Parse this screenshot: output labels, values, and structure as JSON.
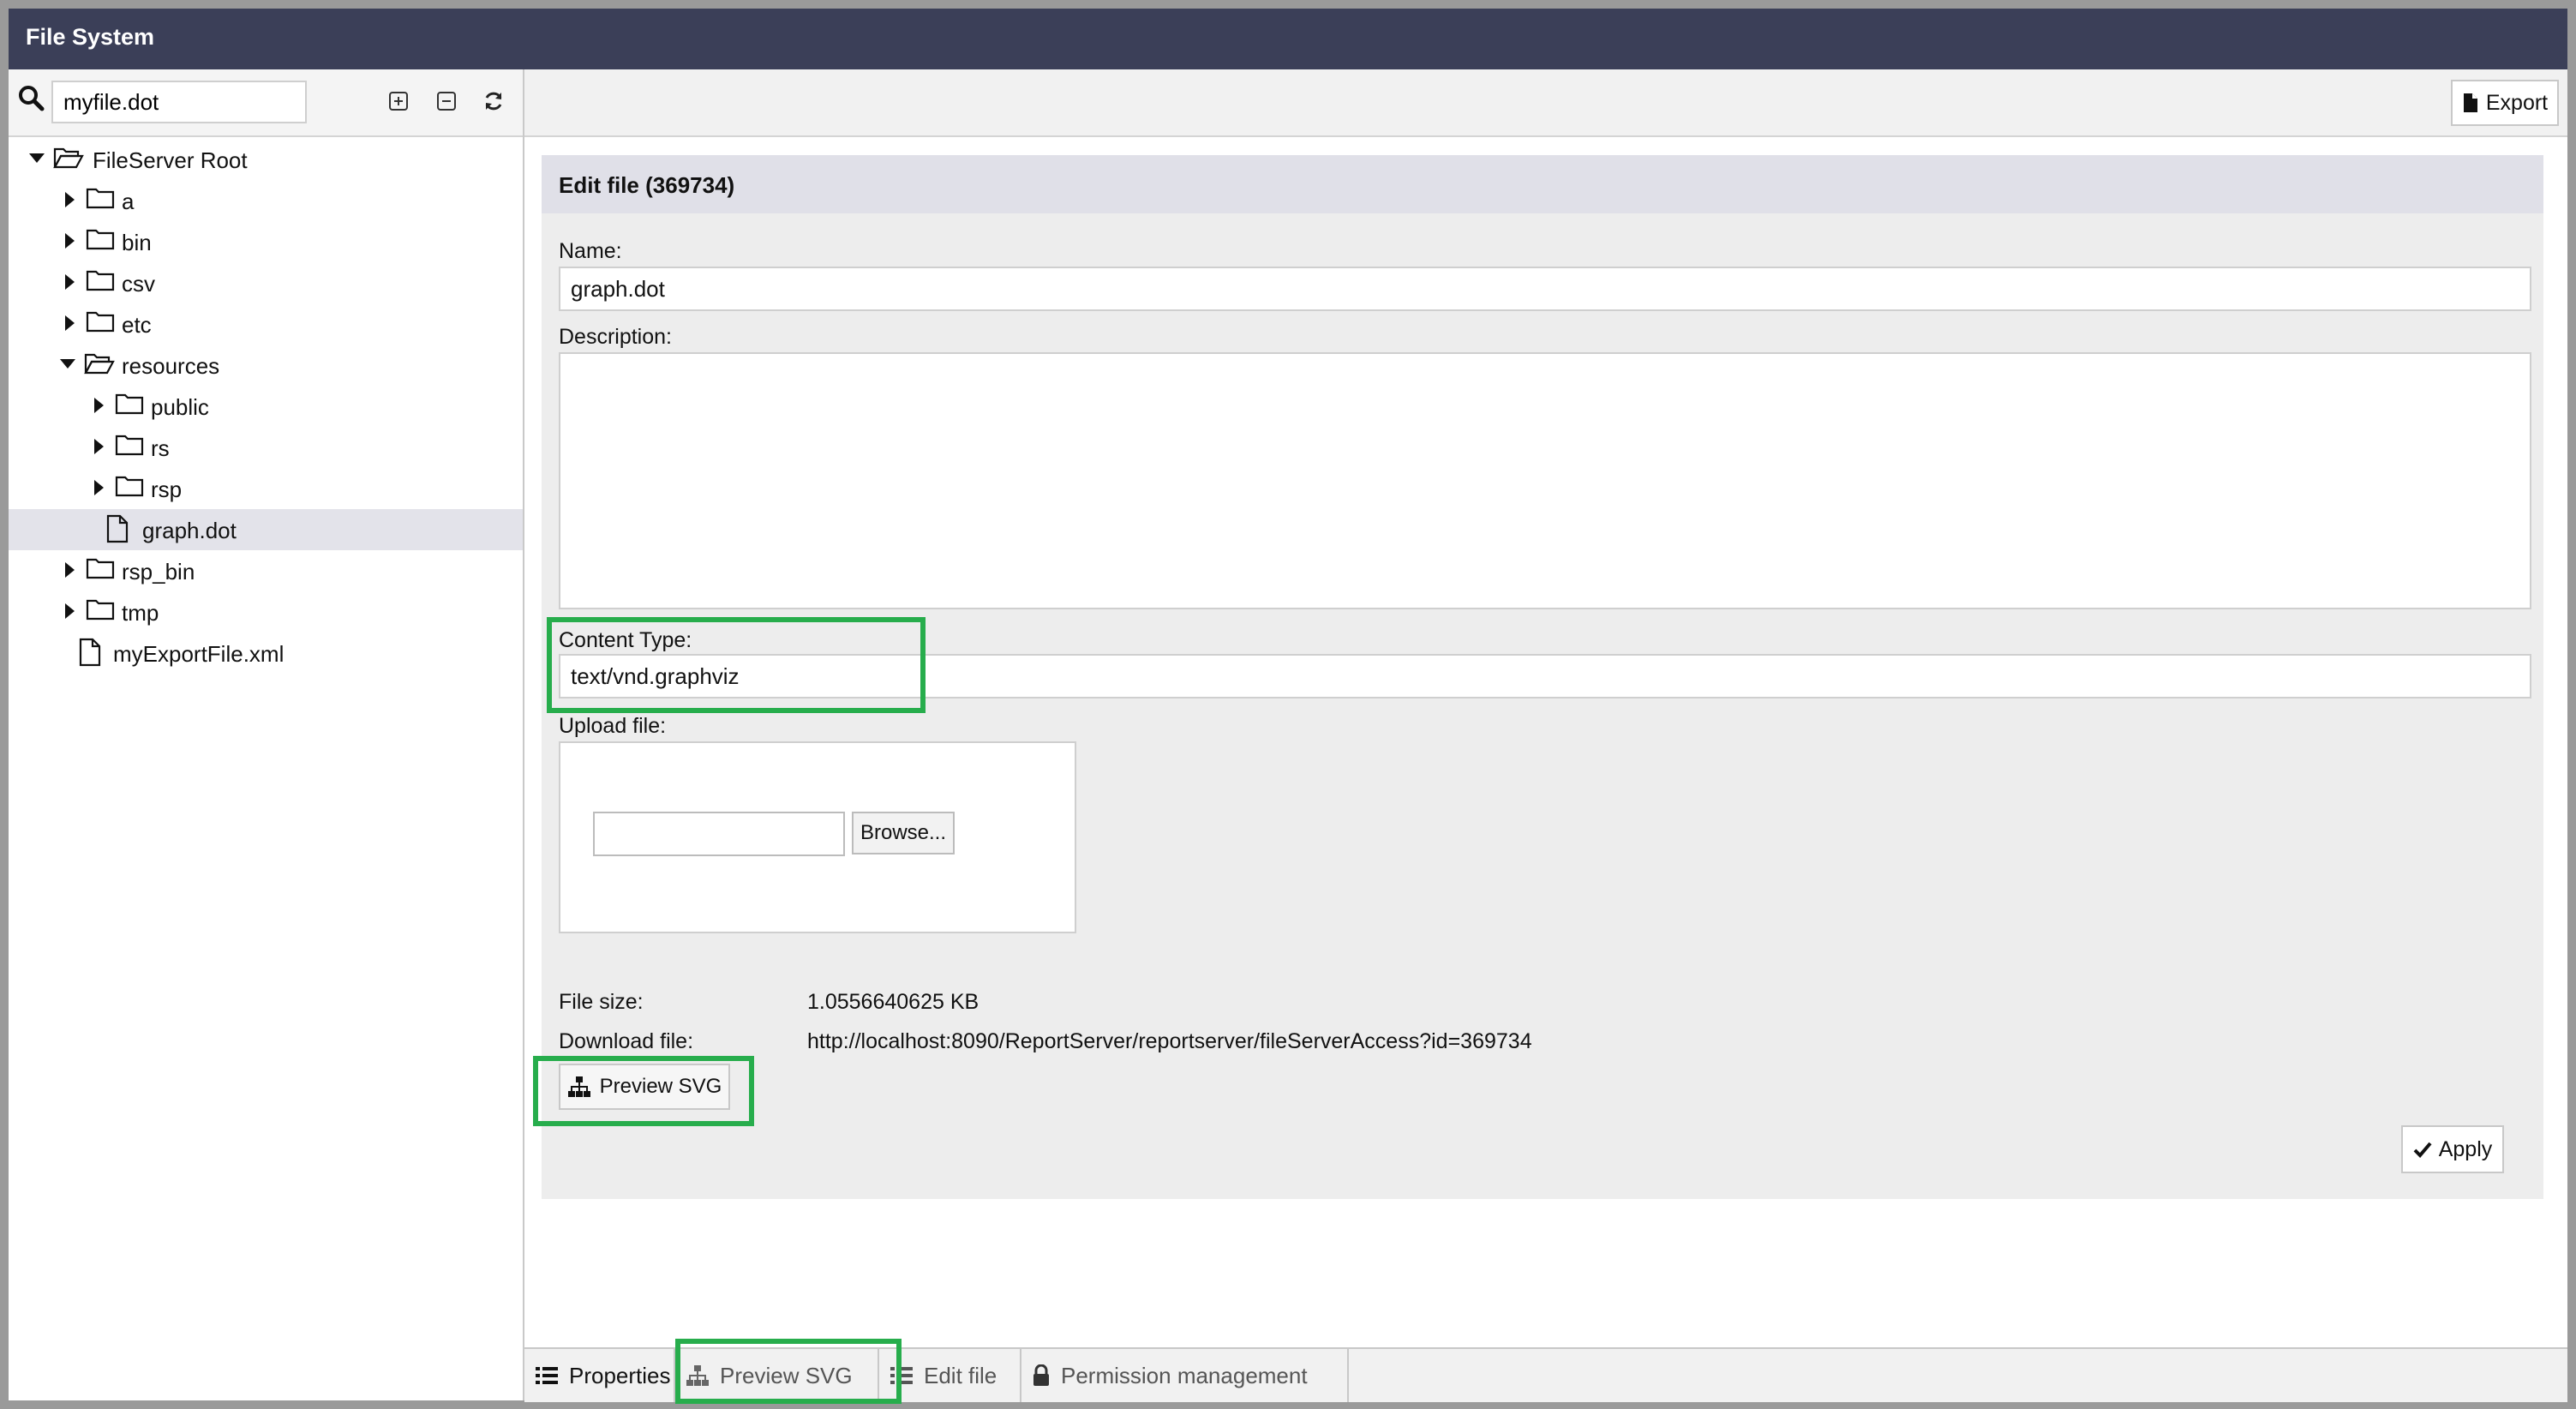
{
  "window": {
    "title": "File System"
  },
  "left": {
    "search_value": "myfile.dot",
    "tree": [
      {
        "label": "FileServer Root",
        "icon": "folder-open-icon"
      },
      {
        "label": "a",
        "icon": "folder-icon"
      },
      {
        "label": "bin",
        "icon": "folder-icon"
      },
      {
        "label": "csv",
        "icon": "folder-icon"
      },
      {
        "label": "etc",
        "icon": "folder-icon"
      },
      {
        "label": "resources",
        "icon": "folder-open-icon"
      },
      {
        "label": "public",
        "icon": "folder-icon"
      },
      {
        "label": "rs",
        "icon": "folder-icon"
      },
      {
        "label": "rsp",
        "icon": "folder-icon"
      },
      {
        "label": "graph.dot",
        "icon": "file-icon",
        "selected": true
      },
      {
        "label": "rsp_bin",
        "icon": "folder-icon"
      },
      {
        "label": "tmp",
        "icon": "folder-icon"
      },
      {
        "label": "myExportFile.xml",
        "icon": "file-icon"
      }
    ]
  },
  "toolbar": {
    "export_label": "Export"
  },
  "form": {
    "header": "Edit file (369734)",
    "name_label": "Name:",
    "name_value": "graph.dot",
    "description_label": "Description:",
    "description_value": "",
    "content_type_label": "Content Type:",
    "content_type_value": "text/vnd.graphviz",
    "upload_label": "Upload file:",
    "browse_label": "Browse...",
    "file_size_label": "File size:",
    "file_size_value": "1.0556640625 KB",
    "download_label": "Download file:",
    "download_value": "http://localhost:8090/ReportServer/reportserver/fileServerAccess?id=369734",
    "preview_label": "Preview SVG",
    "apply_label": "Apply"
  },
  "tabs": [
    {
      "label": "Properties"
    },
    {
      "label": "Preview SVG"
    },
    {
      "label": "Edit file"
    },
    {
      "label": "Permission management"
    }
  ],
  "colors": {
    "titlebar": "#3b3f58",
    "highlight": "#27ad4c",
    "selected_row": "#e3e3ea"
  }
}
